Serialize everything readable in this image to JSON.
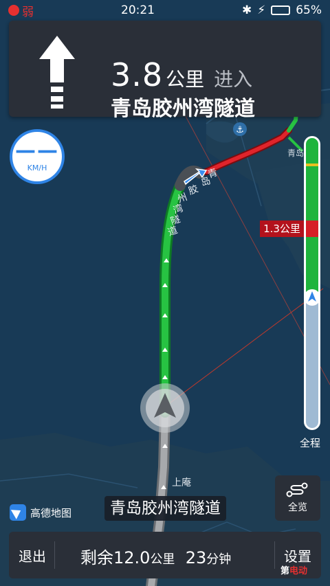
{
  "status_bar": {
    "signal_text": "弱",
    "time": "20:21",
    "battery_percent": "65%",
    "battery_level": 0.65,
    "icons": [
      "bluetooth-icon",
      "charging-icon",
      "battery-icon"
    ]
  },
  "guidance": {
    "distance_value": "3.8",
    "distance_unit": "公里",
    "action": "进入",
    "road_name": "青岛胶州湾隧道",
    "maneuver_icon": "straight-arrow-icon"
  },
  "speed": {
    "value": "——",
    "unit": "KM/H"
  },
  "progress": {
    "marker_label": "1.3公里",
    "whole_route_label": "全程",
    "traveled_fraction": 0.55
  },
  "map": {
    "place_label": "上庵",
    "tunnel_label_chars": [
      "青",
      "岛",
      "胶",
      "州",
      "湾",
      "隧",
      "道"
    ],
    "city_label": "青岛"
  },
  "brand": {
    "name": "高德地图"
  },
  "current_road": "青岛胶州湾隧道",
  "overview_button": {
    "label": "全览"
  },
  "bottom_panel": {
    "exit_label": "退出",
    "remain_prefix": "剩余",
    "remain_distance": "12.0",
    "remain_distance_unit": "公里",
    "remain_time": "23",
    "remain_time_unit": "分钟",
    "settings_label": "设置"
  },
  "watermark": {
    "part1": "第",
    "part2": "电动"
  },
  "colors": {
    "map_water": "#153a5a",
    "land": "#1d3c52",
    "route_green": "#1fb43c",
    "route_red": "#d61f26",
    "card_bg": "#2a2f38",
    "accent_blue": "#2f84e6"
  }
}
